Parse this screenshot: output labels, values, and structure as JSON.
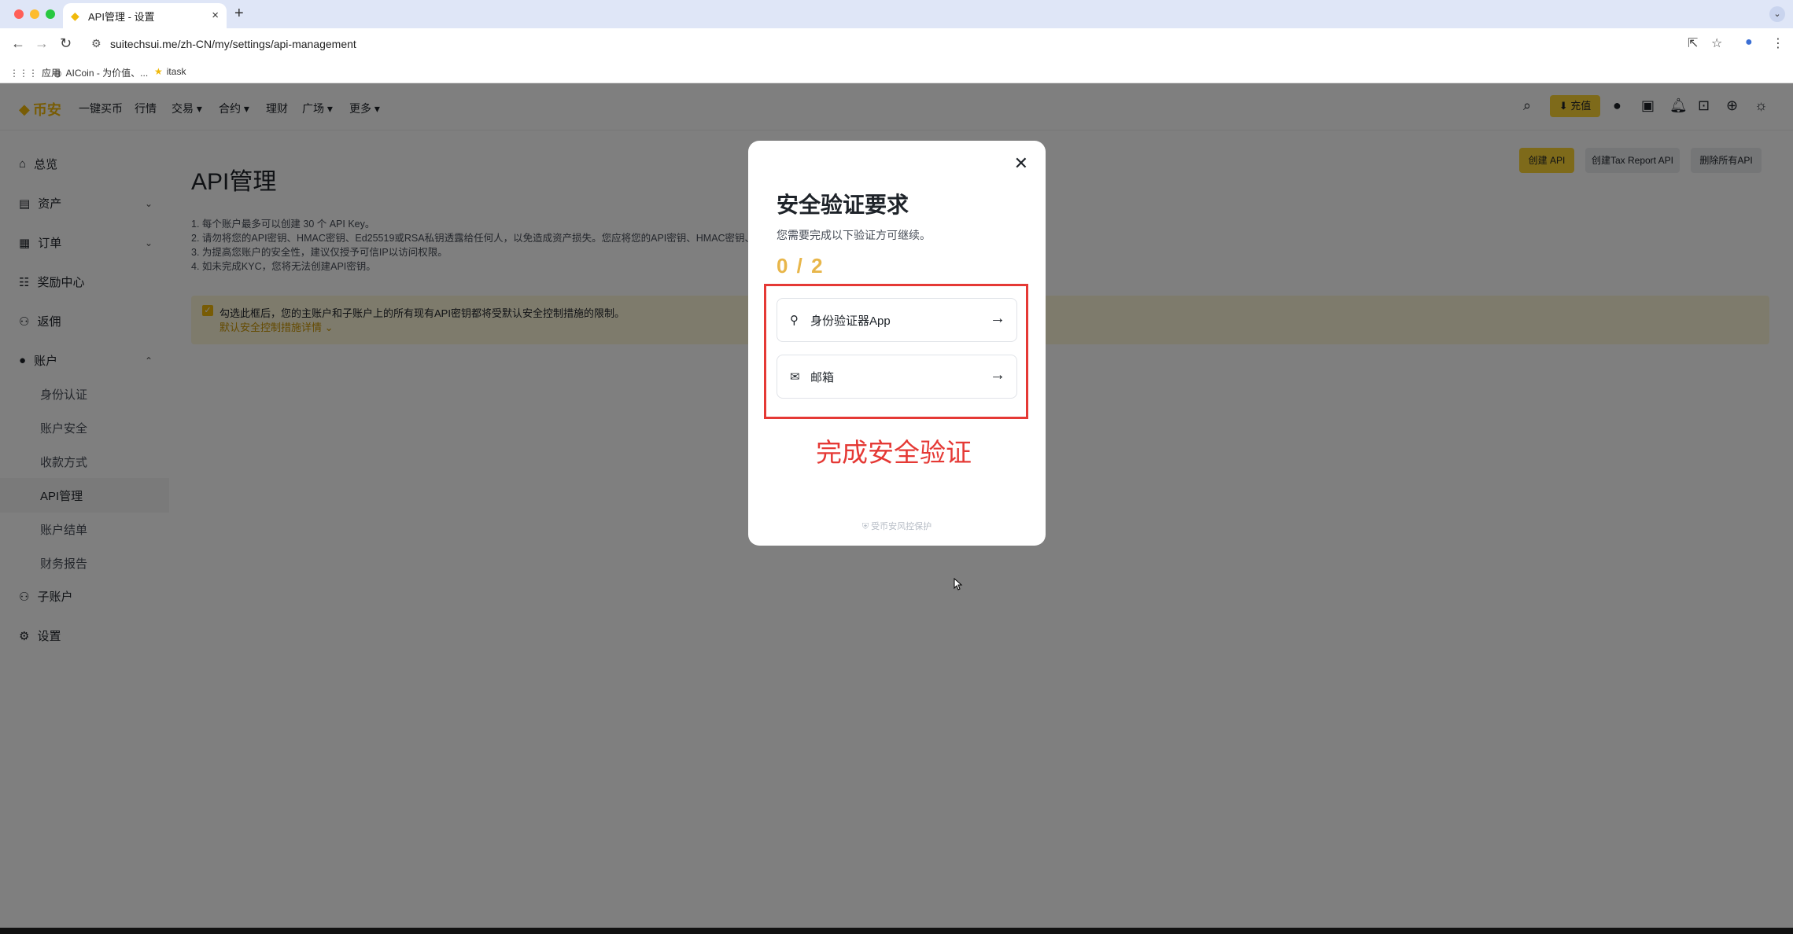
{
  "browser": {
    "tab_title": "API管理 - 设置",
    "tab_close": "×",
    "new_tab": "+",
    "url": "suitechsui.me/zh-CN/my/settings/api-management",
    "bookmarks": [
      {
        "label": "应用",
        "icon": "grid-icon"
      },
      {
        "label": "AICoin - 为价值、...",
        "icon": "aicoin-icon"
      },
      {
        "label": "itask",
        "icon": "star-folder-icon"
      }
    ]
  },
  "topnav": {
    "logo": "币安",
    "items": [
      "一键买币",
      "行情",
      "交易 ▾",
      "合约 ▾",
      "理财",
      "广场 ▾",
      "更多 ▾"
    ],
    "deposit": "⬇ 充值"
  },
  "sidebar": {
    "items": [
      {
        "label": "总览",
        "icon": "⌂"
      },
      {
        "label": "资产",
        "icon": "▤",
        "chev": "⌄"
      },
      {
        "label": "订单",
        "icon": "▦",
        "chev": "⌄"
      },
      {
        "label": "奖励中心",
        "icon": "☷"
      },
      {
        "label": "返佣",
        "icon": "⚇"
      },
      {
        "label": "账户",
        "icon": "●",
        "chev": "⌃"
      }
    ],
    "sub_items": [
      "身份认证",
      "账户安全",
      "收款方式",
      "API管理",
      "账户结单",
      "财务报告"
    ],
    "bottom_items": [
      {
        "label": "子账户",
        "icon": "⚇"
      },
      {
        "label": "设置",
        "icon": "⚙"
      }
    ]
  },
  "main": {
    "title": "API管理",
    "notes": [
      "1. 每个账户最多可以创建 30 个 API Key。",
      "2. 请勿将您的API密钥、HMAC密钥、Ed25519或RSA私钥透露给任何人，以免造成资产损失。您应将您的API密钥、HMAC密钥、E",
      "3. 为提高您账户的安全性，建议仅授予可信IP以访问权限。",
      "4. 如未完成KYC，您将无法创建API密钥。"
    ],
    "buttons": {
      "create": "创建 API",
      "create_tax": "创建Tax Report API",
      "delete_all": "删除所有API"
    },
    "warning": {
      "check": "✓",
      "text": "勾选此框后，您的主账户和子账户上的所有现有API密钥都将受默认安全控制措施的限制。",
      "link": "默认安全控制措施详情 ⌄"
    }
  },
  "modal": {
    "close": "✕",
    "title": "安全验证要求",
    "subtitle": "您需要完成以下验证方可继续。",
    "progress": "0 / 2",
    "options": [
      {
        "label": "身份验证器App",
        "icon": "authenticator-icon"
      },
      {
        "label": "邮箱",
        "icon": "mail-icon"
      }
    ],
    "arrow": "→",
    "annotation": "完成安全验证",
    "footer": "受币安风控保护"
  }
}
